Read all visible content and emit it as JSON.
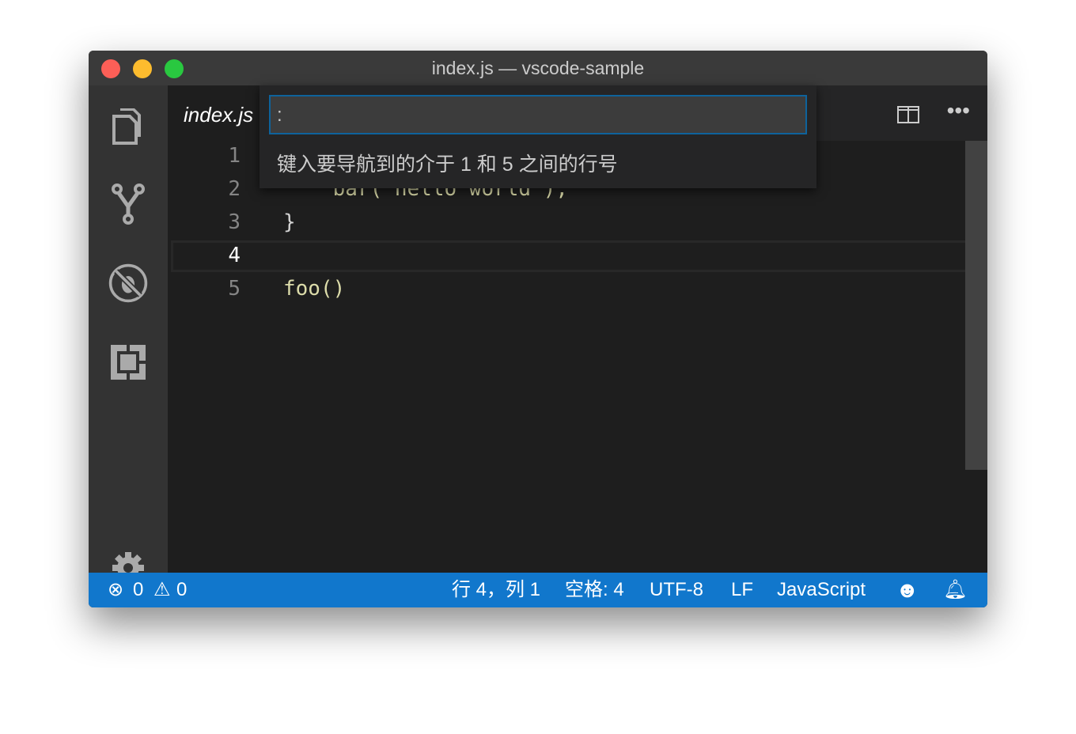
{
  "window": {
    "title": "index.js — vscode-sample"
  },
  "tab": {
    "label": "index.js"
  },
  "editor": {
    "lines": [
      {
        "number": "1",
        "text": ""
      },
      {
        "number": "2",
        "text": "    bar(\"hello world\");"
      },
      {
        "number": "3",
        "text": "}"
      },
      {
        "number": "4",
        "text": ""
      },
      {
        "number": "5",
        "text": "foo()"
      }
    ]
  },
  "quick_open": {
    "value": ":",
    "message": "键入要导航到的介于 1 和 5 之间的行号"
  },
  "status": {
    "errors": "0",
    "warnings": "0",
    "position": "行 4，列 1",
    "indent": "空格: 4",
    "encoding": "UTF-8",
    "eol": "LF",
    "language": "JavaScript"
  },
  "colors": {
    "status_bar": "#1177cc",
    "accent": "#0e639c"
  }
}
